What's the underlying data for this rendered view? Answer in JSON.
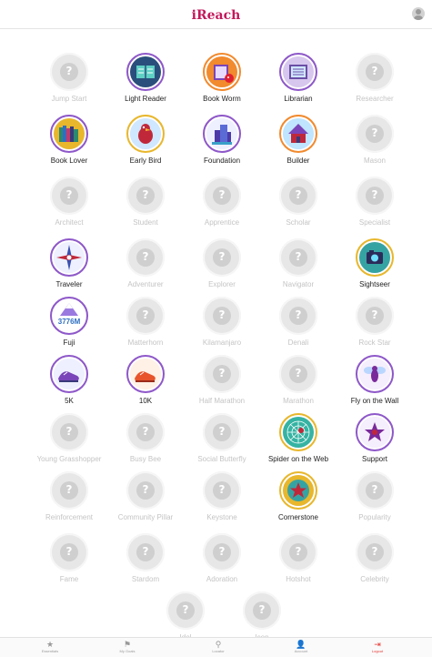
{
  "app": {
    "title": "iReach"
  },
  "badges": [
    {
      "label": "Jump Start",
      "earned": false,
      "icon": "question-icon"
    },
    {
      "label": "Light Reader",
      "earned": true,
      "icon": "open-book-icon"
    },
    {
      "label": "Book Worm",
      "earned": true,
      "icon": "bookworm-icon"
    },
    {
      "label": "Librarian",
      "earned": true,
      "icon": "library-book-icon"
    },
    {
      "label": "Researcher",
      "earned": false,
      "icon": "question-icon"
    },
    {
      "label": "Book Lover",
      "earned": true,
      "icon": "bookshelf-icon"
    },
    {
      "label": "Early Bird",
      "earned": true,
      "icon": "bird-icon"
    },
    {
      "label": "Foundation",
      "earned": true,
      "icon": "building-icon"
    },
    {
      "label": "Builder",
      "earned": true,
      "icon": "house-icon"
    },
    {
      "label": "Mason",
      "earned": false,
      "icon": "question-icon"
    },
    {
      "label": "Architect",
      "earned": false,
      "icon": "question-icon"
    },
    {
      "label": "Student",
      "earned": false,
      "icon": "question-icon"
    },
    {
      "label": "Apprentice",
      "earned": false,
      "icon": "question-icon"
    },
    {
      "label": "Scholar",
      "earned": false,
      "icon": "question-icon"
    },
    {
      "label": "Specialist",
      "earned": false,
      "icon": "question-icon"
    },
    {
      "label": "Traveler",
      "earned": true,
      "icon": "compass-icon"
    },
    {
      "label": "Adventurer",
      "earned": false,
      "icon": "question-icon"
    },
    {
      "label": "Explorer",
      "earned": false,
      "icon": "question-icon"
    },
    {
      "label": "Navigator",
      "earned": false,
      "icon": "question-icon"
    },
    {
      "label": "Sightseer",
      "earned": true,
      "icon": "camera-icon"
    },
    {
      "label": "Fuji",
      "earned": true,
      "icon": "mountain-icon",
      "art_text": "3776M"
    },
    {
      "label": "Matterhorn",
      "earned": false,
      "icon": "question-icon"
    },
    {
      "label": "Kilamanjaro",
      "earned": false,
      "icon": "question-icon"
    },
    {
      "label": "Denali",
      "earned": false,
      "icon": "question-icon"
    },
    {
      "label": "Rock Star",
      "earned": false,
      "icon": "question-icon"
    },
    {
      "label": "5K",
      "earned": true,
      "icon": "running-shoe-icon"
    },
    {
      "label": "10K",
      "earned": true,
      "icon": "running-shoe-icon"
    },
    {
      "label": "Half Marathon",
      "earned": false,
      "icon": "question-icon"
    },
    {
      "label": "Marathon",
      "earned": false,
      "icon": "question-icon"
    },
    {
      "label": "Fly on the Wall",
      "earned": true,
      "icon": "fly-icon"
    },
    {
      "label": "Young Grasshopper",
      "earned": false,
      "icon": "question-icon"
    },
    {
      "label": "Busy Bee",
      "earned": false,
      "icon": "question-icon"
    },
    {
      "label": "Social Butterfly",
      "earned": false,
      "icon": "question-icon"
    },
    {
      "label": "Spider on the Web",
      "earned": true,
      "icon": "spider-web-icon"
    },
    {
      "label": "Support",
      "earned": true,
      "icon": "star-support-icon"
    },
    {
      "label": "Reinforcement",
      "earned": false,
      "icon": "question-icon"
    },
    {
      "label": "Community Pillar",
      "earned": false,
      "icon": "question-icon"
    },
    {
      "label": "Keystone",
      "earned": false,
      "icon": "question-icon"
    },
    {
      "label": "Cornerstone",
      "earned": true,
      "icon": "star-stone-icon"
    },
    {
      "label": "Popularity",
      "earned": false,
      "icon": "question-icon"
    },
    {
      "label": "Fame",
      "earned": false,
      "icon": "question-icon"
    },
    {
      "label": "Stardom",
      "earned": false,
      "icon": "question-icon"
    },
    {
      "label": "Adoration",
      "earned": false,
      "icon": "question-icon"
    },
    {
      "label": "Hotshot",
      "earned": false,
      "icon": "question-icon"
    },
    {
      "label": "Celebrity",
      "earned": false,
      "icon": "question-icon"
    },
    {
      "label": "Idol",
      "earned": false,
      "icon": "question-icon"
    },
    {
      "label": "Icon",
      "earned": false,
      "icon": "question-icon"
    }
  ],
  "locked_glyph": "?",
  "tabbar": {
    "items": [
      {
        "label": "Essentials",
        "icon": "star-icon",
        "glyph": "★",
        "active": false
      },
      {
        "label": "My Goals",
        "icon": "flag-icon",
        "glyph": "⚑",
        "active": false
      },
      {
        "label": "Locator",
        "icon": "map-pin-icon",
        "glyph": "⚲",
        "active": false
      },
      {
        "label": "Account",
        "icon": "person-icon",
        "glyph": "👤",
        "active": false
      },
      {
        "label": "Logout",
        "icon": "logout-icon",
        "glyph": "⇥",
        "active": true
      }
    ]
  },
  "colors": {
    "title": "#c2185b",
    "earned_ring": "#8e58c9",
    "locked_circle": "#e7e7e7",
    "locked_label": "#c4c4c4",
    "active_tab": "#e53935"
  }
}
